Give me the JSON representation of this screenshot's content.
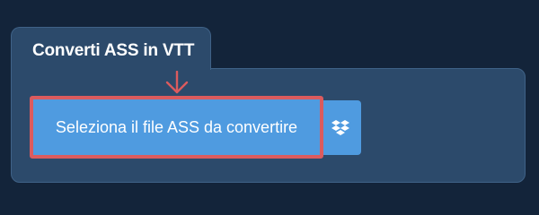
{
  "tab": {
    "title": "Converti ASS in VTT"
  },
  "upload": {
    "select_label": "Seleziona il file ASS da convertire",
    "dropbox_icon": "dropbox-icon",
    "arrow_icon": "arrow-down-icon"
  },
  "colors": {
    "page_background": "#13243a",
    "panel_background": "#2c4a6b",
    "button_background": "#4f9be0",
    "highlight_border": "#db5b5e"
  }
}
